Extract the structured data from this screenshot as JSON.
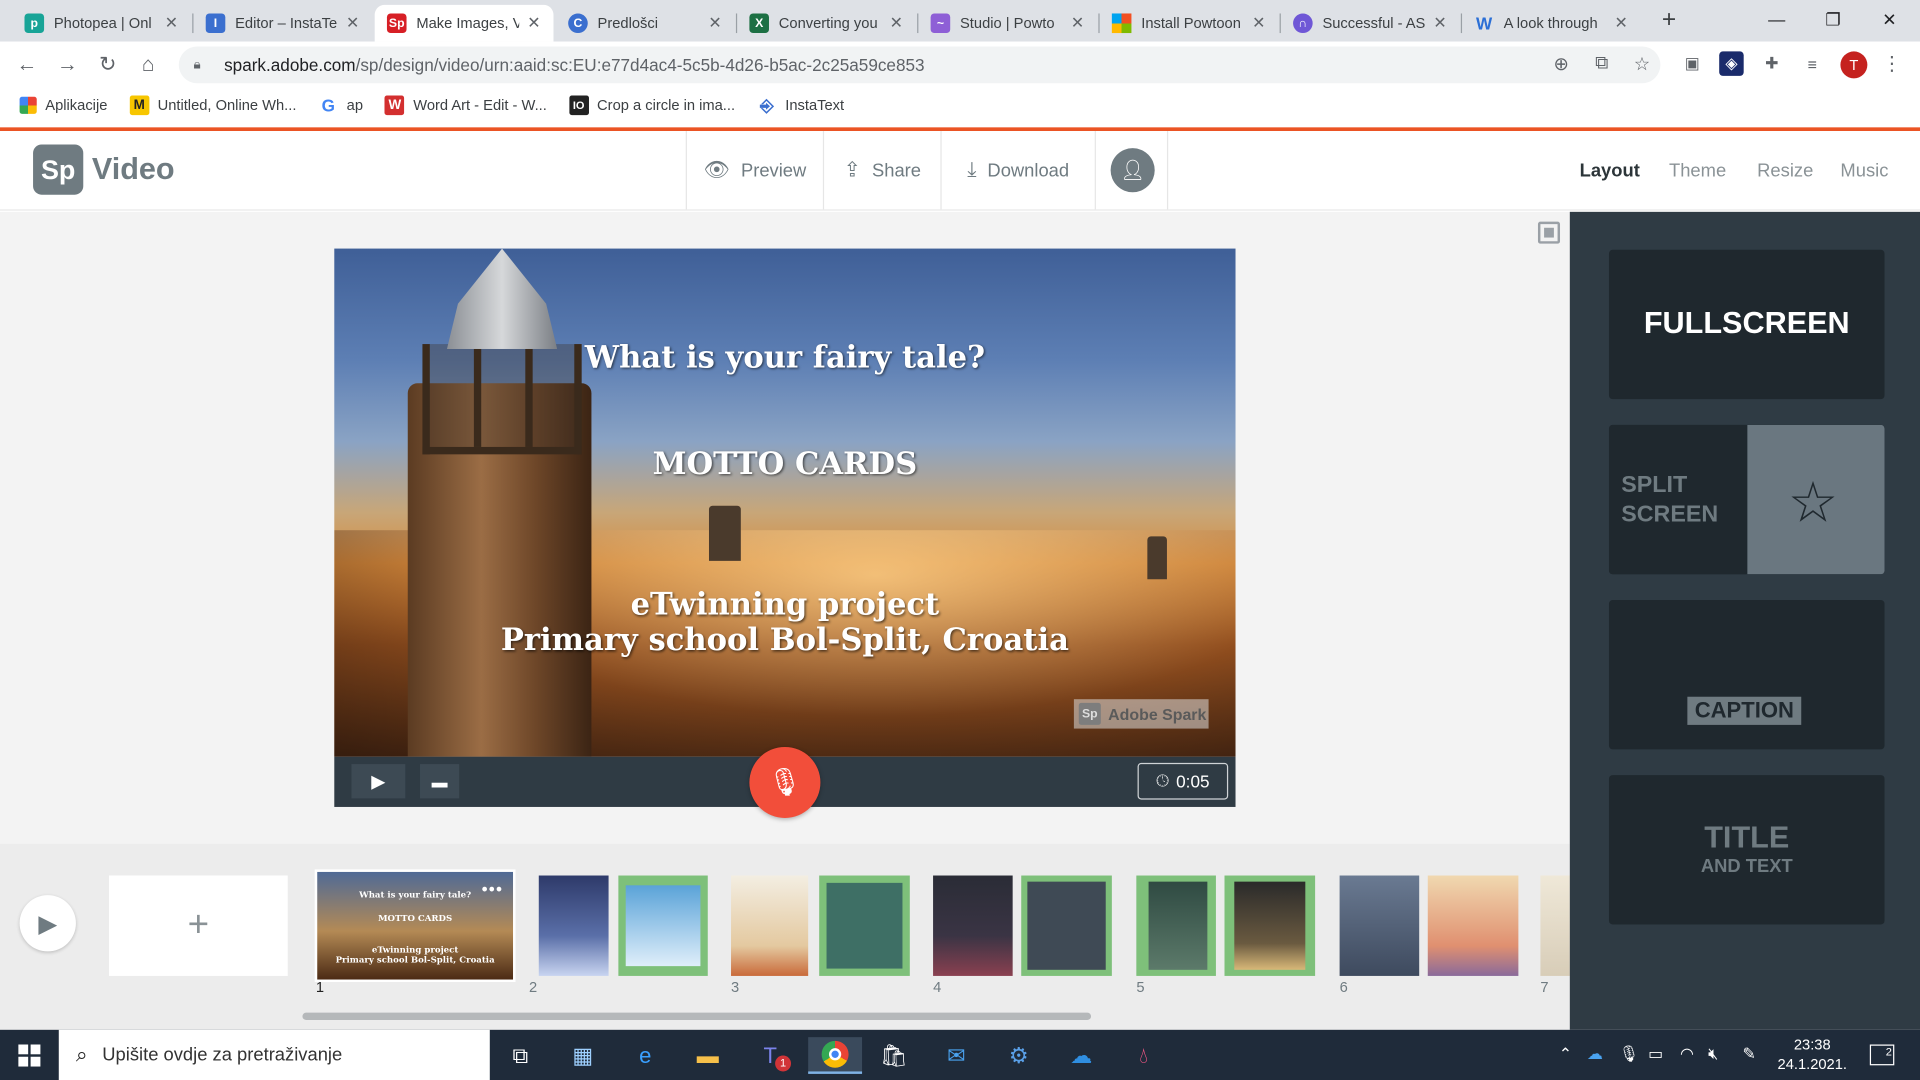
{
  "browser": {
    "tabs": [
      {
        "title": "Photopea | Onl",
        "favicon": "photopea-icon",
        "color": "#18a497"
      },
      {
        "title": "Editor – InstaTe",
        "favicon": "instatext-icon",
        "color": "#3b6fcf"
      },
      {
        "title": "Make Images, V",
        "favicon": "adobe-spark-icon",
        "color": "#d71f26",
        "active": true
      },
      {
        "title": "Predlošci",
        "favicon": "canva-icon",
        "color": "#3b6fcf"
      },
      {
        "title": "Converting you",
        "favicon": "excel-icon",
        "color": "#1d7044"
      },
      {
        "title": "Studio | Powto",
        "favicon": "powtoon-icon",
        "color": "#8e5fd6"
      },
      {
        "title": "Install Powtoon",
        "favicon": "microsoft-icon",
        "color": "#f25022"
      },
      {
        "title": "Successful - AS",
        "favicon": "successful-icon",
        "color": "#6f57d6"
      },
      {
        "title": "A look through",
        "favicon": "word-icon",
        "color": "#2b6fd6"
      }
    ],
    "url_main": "spark.adobe.com",
    "url_path": "/sp/design/video/urn:aaid:sc:EU:e77d4ac4-5c5b-4d26-b5ac-2c25a59ce853",
    "profile_initial": "T",
    "bookmarks": [
      {
        "label": "Aplikacije",
        "icon": "apps-grid-icon"
      },
      {
        "label": "Untitled, Online Wh...",
        "icon": "whiteboard-icon"
      },
      {
        "label": "ap",
        "icon": "google-icon"
      },
      {
        "label": "Word Art - Edit - W...",
        "icon": "wordart-icon"
      },
      {
        "label": "Crop a circle in ima...",
        "icon": "io-icon"
      },
      {
        "label": "InstaText",
        "icon": "instatext-icon"
      }
    ]
  },
  "spark": {
    "logo": "Sp",
    "app_name": "Video",
    "actions": {
      "preview": "Preview",
      "share": "Share",
      "download": "Download"
    },
    "right_tabs": [
      "Layout",
      "Theme",
      "Resize",
      "Music"
    ],
    "active_tab": "Layout"
  },
  "slide": {
    "title": "What is your fairy tale?",
    "subtitle": "MOTTO CARDS",
    "line1": "eTwinning project",
    "line2": "Primary school Bol-Split, Croatia",
    "watermark_logo": "Sp",
    "watermark": "Adobe Spark",
    "duration": "0:05"
  },
  "filmstrip": {
    "add_label": "+",
    "slides": [
      {
        "number": "1",
        "thumb_title": "What is your fairy tale?",
        "thumb_sub": "MOTTO CARDS",
        "thumb_l1": "eTwinning project",
        "thumb_l2": "Primary school Bol-Split, Croatia"
      },
      {
        "number": "2",
        "colors": [
          "#3b4a7a",
          "#7ec07a"
        ]
      },
      {
        "number": "3",
        "colors": [
          "#e8dfc8",
          "#5c8f7e"
        ]
      },
      {
        "number": "4",
        "colors": [
          "#3a3a48",
          "#5a6a6a"
        ]
      },
      {
        "number": "5",
        "colors": [
          "#3e5a4a",
          "#7ec07a"
        ]
      },
      {
        "number": "6",
        "colors": [
          "#6d7a8a",
          "#e0b07a"
        ]
      },
      {
        "number": "7",
        "colors": [
          "#e8e0d0"
        ]
      }
    ]
  },
  "layouts": {
    "fullscreen": "FULLSCREEN",
    "split_1": "SPLIT",
    "split_2": "SCREEN",
    "caption": "CAPTION",
    "title": "TITLE",
    "title_sub": "AND TEXT"
  },
  "taskbar": {
    "search_placeholder": "Upišite ovdje za pretraživanje",
    "time": "23:38",
    "date": "24.1.2021.",
    "notifications": "2",
    "teams_badge": "1"
  }
}
